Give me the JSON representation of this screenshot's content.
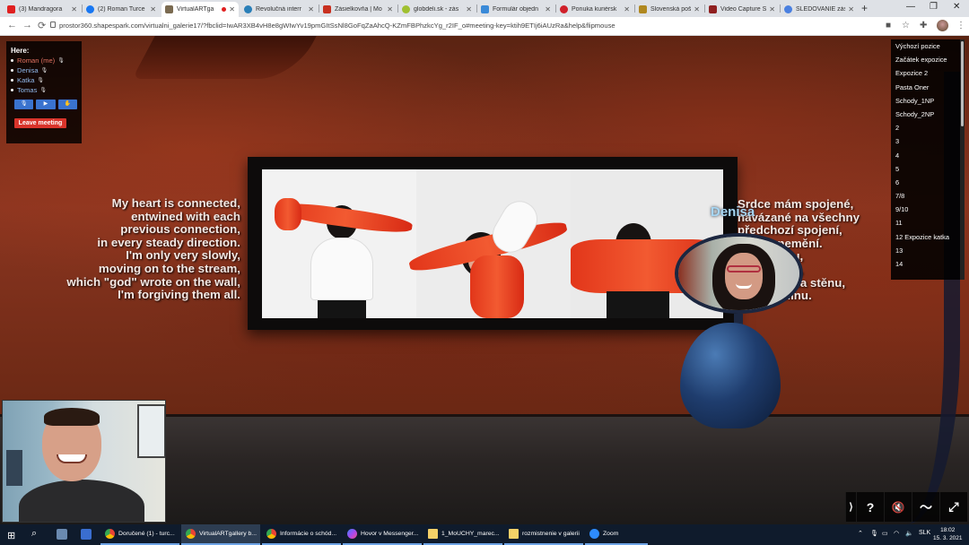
{
  "browser": {
    "tabs": [
      {
        "label": "(3) Mandragora",
        "color": "#e02020"
      },
      {
        "label": "(2) Roman Turce",
        "color": "#1877f2"
      },
      {
        "label": "VirtualARTga",
        "color": "#7a6a50",
        "active": true
      },
      {
        "label": "Revolučná interr",
        "color": "#2a7fb8"
      },
      {
        "label": "Zásielkovňa | Mo",
        "color": "#c83020"
      },
      {
        "label": "globdeli.sk - zás",
        "color": "#a0c030"
      },
      {
        "label": "Formulár objedn",
        "color": "#3a8ad8"
      },
      {
        "label": "Ponuka kuriérsk",
        "color": "#d0202a"
      },
      {
        "label": "Slovenská pošta",
        "color": "#b08820"
      },
      {
        "label": "Video Capture S",
        "color": "#902020"
      },
      {
        "label": "SLEDOVANIE zás",
        "color": "#4a80e0"
      }
    ],
    "new_tab": "+",
    "window_controls": [
      "—",
      "❐",
      "✕"
    ],
    "url": "prostor360.shapespark.com/virtualni_galerie17/?fbclid=IwAR3XB4vH8e8gWIwYv19pmGItSsNl8GoFqZaAhcQ-KZmFBPhzkcYg_r2IF_o#meeting-key=ktih9ETIj6iAUzRa&help&flipmouse",
    "nav": {
      "back": "←",
      "forward": "→",
      "reload": "⟳"
    }
  },
  "meeting": {
    "title": "Here:",
    "participants": [
      {
        "name": "Roman (me)"
      },
      {
        "name": "Denisa"
      },
      {
        "name": "Katka"
      },
      {
        "name": "Tomas"
      }
    ],
    "buttons": {
      "mic": "🎙",
      "camera": "▶",
      "hand": "✋"
    },
    "leave": "Leave meeting"
  },
  "viewpoints": [
    "Výchozí pozice",
    "Začátek expozice",
    "Expozice 2",
    "Pasta Oner",
    "Schody_1NP",
    "Schody_2NP",
    "2",
    "3",
    "4",
    "5",
    "6",
    "7/8",
    "9/10",
    "11",
    "12 Expozice katka",
    "13",
    "14"
  ],
  "scene": {
    "left_poem": "My heart is connected,\nentwined with each\nprevious connection,\nin every steady direction.\nI'm only very slowly,\nmoving on to the stream,\nwhich \"god\" wrote on the wall,\nI'm forgiving them all.",
    "right_poem": "Srdce mám spojené,\nnavázané na všechny\npředchozí spojení,\n       se nemění.\n      pomalu,\n       otúčku,\n       Bůh\" na stěnu,\n       prominu.",
    "avatar_name": "Denisa"
  },
  "controls": {
    "expand": "⟩",
    "help": "?",
    "mute": "🔇",
    "path": "〜",
    "fullscreen": "⤢"
  },
  "taskbar": {
    "apps": [
      {
        "label": "Doručené (1) - turc...",
        "color": "#f3b528"
      },
      {
        "label": "VirtualARTgallery b...",
        "color": "#f3b528",
        "active": true
      },
      {
        "label": "Informácie o schód...",
        "color": "#f3b528"
      },
      {
        "label": "Hovor v Messenger...",
        "color": "#a34bf2"
      },
      {
        "label": "1_MoUCHY_marec...",
        "color": "#f3d068"
      },
      {
        "label": "rozmistnenie v galerii",
        "color": "#f3d068"
      },
      {
        "label": "Zoom",
        "color": "#2d8cff"
      }
    ],
    "language": "SLK",
    "time": "18:02",
    "date": "15. 3. 2021"
  }
}
